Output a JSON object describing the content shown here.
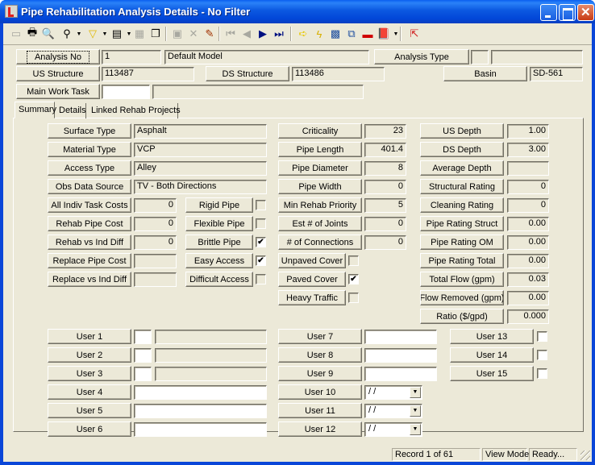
{
  "window": {
    "title": "Pipe Rehabilitation Analysis Details - No Filter",
    "controls": [
      "minimize",
      "maximize",
      "close"
    ]
  },
  "toolbar": {
    "icons": [
      {
        "name": "form-view-icon",
        "glyph": "▭",
        "enabled": false
      },
      {
        "name": "print-icon",
        "glyph": "🖶",
        "enabled": true
      },
      {
        "name": "print-preview-icon",
        "glyph": "🔍",
        "enabled": true
      },
      {
        "name": "find-icon",
        "glyph": "⚲",
        "enabled": true,
        "dropdown": true
      },
      {
        "name": "filter-icon",
        "glyph": "▽",
        "enabled": true,
        "dropdown": true
      },
      {
        "name": "report-icon",
        "glyph": "▤",
        "enabled": true,
        "dropdown": true
      },
      {
        "name": "properties-icon",
        "glyph": "▦",
        "enabled": false
      },
      {
        "name": "copy-record-icon",
        "glyph": "❐",
        "enabled": true
      },
      {
        "name": "save-icon",
        "glyph": "▣",
        "enabled": false
      },
      {
        "name": "delete-icon",
        "glyph": "✕",
        "enabled": false
      },
      {
        "name": "edit-icon",
        "glyph": "✎",
        "enabled": true
      },
      {
        "name": "first-record-icon",
        "glyph": "⏮",
        "enabled": false
      },
      {
        "name": "previous-record-icon",
        "glyph": "◀",
        "enabled": false
      },
      {
        "name": "next-record-icon",
        "glyph": "▶",
        "enabled": true
      },
      {
        "name": "last-record-icon",
        "glyph": "⏭",
        "enabled": true
      },
      {
        "name": "goto-icon",
        "glyph": "➪",
        "enabled": true
      },
      {
        "name": "lightning-icon",
        "glyph": "ϟ",
        "enabled": true
      },
      {
        "name": "map-select-icon",
        "glyph": "▩",
        "enabled": true
      },
      {
        "name": "network-icon",
        "glyph": "⧉",
        "enabled": true
      },
      {
        "name": "toolbox-icon",
        "glyph": "▬",
        "enabled": true
      },
      {
        "name": "book-icon",
        "glyph": "📕",
        "enabled": true,
        "dropdown": true
      },
      {
        "name": "export-icon",
        "glyph": "⇱",
        "enabled": true
      }
    ]
  },
  "header": {
    "analysis_no": {
      "label": "Analysis No",
      "value": "1",
      "description": "Default Model"
    },
    "analysis_type": {
      "label": "Analysis Type",
      "code": "",
      "description": ""
    },
    "us_structure": {
      "label": "US Structure",
      "value": "113487"
    },
    "ds_structure": {
      "label": "DS Structure",
      "value": "113486"
    },
    "basin": {
      "label": "Basin",
      "value": "SD-561"
    },
    "main_work_task": {
      "label": "Main Work Task",
      "code": "",
      "description": ""
    }
  },
  "tabs": [
    {
      "label": "Summary",
      "active": true
    },
    {
      "label": "Details",
      "active": false
    },
    {
      "label": "Linked Rehab Projects",
      "active": false
    }
  ],
  "summary": {
    "text_fields": [
      {
        "label": "Surface Type",
        "value": "Asphalt"
      },
      {
        "label": "Material Type",
        "value": "VCP"
      },
      {
        "label": "Access Type",
        "value": "Alley"
      },
      {
        "label": "Obs Data Source",
        "value": "TV - Both Directions"
      }
    ],
    "cost_fields": [
      {
        "label": "All Indiv Task Costs",
        "value": "0"
      },
      {
        "label": "Rehab Pipe Cost",
        "value": "0"
      },
      {
        "label": "Rehab vs Ind Diff",
        "value": "0"
      },
      {
        "label": "Replace Pipe Cost",
        "value": ""
      },
      {
        "label": "Replace vs Ind Diff",
        "value": ""
      }
    ],
    "pipe_flags": [
      {
        "label": "Rigid Pipe",
        "checked": false
      },
      {
        "label": "Flexible Pipe",
        "checked": false
      },
      {
        "label": "Brittle Pipe",
        "checked": true
      },
      {
        "label": "Easy Access",
        "checked": true
      },
      {
        "label": "Difficult Access",
        "checked": false
      }
    ],
    "pipe_metrics": [
      {
        "label": "Criticality",
        "value": "23"
      },
      {
        "label": "Pipe Length",
        "value": "401.4"
      },
      {
        "label": "Pipe Diameter",
        "value": "8"
      },
      {
        "label": "Pipe Width",
        "value": "0"
      },
      {
        "label": "Min Rehab Priority",
        "value": "5"
      },
      {
        "label": "Est # of Joints",
        "value": "0"
      },
      {
        "label": "# of Connections",
        "value": "0"
      }
    ],
    "cover_flags": [
      {
        "label": "Unpaved Cover",
        "checked": false
      },
      {
        "label": "Paved Cover",
        "checked": true
      },
      {
        "label": "Heavy Traffic",
        "checked": false
      }
    ],
    "ratings": [
      {
        "label": "US Depth",
        "value": "1.00"
      },
      {
        "label": "DS Depth",
        "value": "3.00"
      },
      {
        "label": "Average Depth",
        "value": ""
      },
      {
        "label": "Structural Rating",
        "value": "0"
      },
      {
        "label": "Cleaning Rating",
        "value": "0"
      },
      {
        "label": "Pipe Rating Struct",
        "value": "0.00"
      },
      {
        "label": "Pipe Rating OM",
        "value": "0.00"
      },
      {
        "label": "Pipe Rating Total",
        "value": "0.00"
      },
      {
        "label": "Total Flow (gpm)",
        "value": "0.03"
      },
      {
        "label": "Flow Removed (gpm)",
        "value": "0.00"
      },
      {
        "label": "Ratio ($/gpd)",
        "value": "0.000"
      }
    ],
    "user_lookup": [
      {
        "label": "User 1",
        "code": "",
        "description": ""
      },
      {
        "label": "User 2",
        "code": "",
        "description": ""
      },
      {
        "label": "User 3",
        "code": "",
        "description": ""
      }
    ],
    "user_text_wide": [
      {
        "label": "User 4",
        "value": ""
      },
      {
        "label": "User 5",
        "value": ""
      },
      {
        "label": "User 6",
        "value": ""
      }
    ],
    "user_text": [
      {
        "label": "User 7",
        "value": ""
      },
      {
        "label": "User 8",
        "value": ""
      },
      {
        "label": "User 9",
        "value": ""
      }
    ],
    "user_dates": [
      {
        "label": "User 10",
        "value": " /  /"
      },
      {
        "label": "User 11",
        "value": " /  /"
      },
      {
        "label": "User 12",
        "value": " /  /"
      }
    ],
    "user_flags": [
      {
        "label": "User 13",
        "checked": false
      },
      {
        "label": "User 14",
        "checked": false
      },
      {
        "label": "User 15",
        "checked": false
      }
    ]
  },
  "status": {
    "record": "Record 1 of 61",
    "mode": "View Mode",
    "state": "Ready..."
  },
  "colors": {
    "titlebar": "#0a46d8",
    "face": "#ece9d8",
    "shadow": "#716f64"
  }
}
